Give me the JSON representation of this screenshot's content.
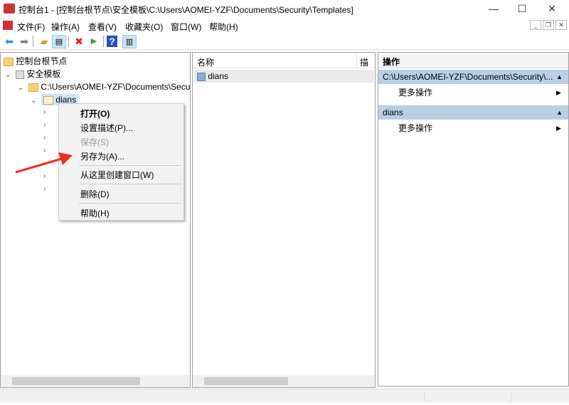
{
  "window": {
    "title": "控制台1 - [控制台根节点\\安全模板\\C:\\Users\\AOMEI-YZF\\Documents\\Security\\Templates]",
    "min": "—",
    "max": "☐",
    "close": "✕"
  },
  "menu": [
    "文件(F)",
    "操作(A)",
    "查看(V)",
    "收藏夹(O)",
    "窗口(W)",
    "帮助(H)"
  ],
  "mdi": {
    "min": "_",
    "restore": "❐",
    "close": "✕"
  },
  "tree": {
    "root": "控制台根节点",
    "templates": "安全模板",
    "path": "C:\\Users\\AOMEI-YZF\\Documents\\Secur",
    "dians": "dians"
  },
  "context_menu": {
    "open": "打开(O)",
    "set_desc": "设置描述(P)...",
    "save": "保存(S)",
    "save_as": "另存为(A)...",
    "new_window": "从这里创建窗口(W)",
    "delete": "删除(D)",
    "help": "帮助(H)"
  },
  "list": {
    "col_name": "名称",
    "col_desc": "描述",
    "items": [
      "dians"
    ]
  },
  "actions": {
    "header": "操作",
    "group1": "C:\\Users\\AOMEI-YZF\\Documents\\Security\\...",
    "group2": "dians",
    "more": "更多操作"
  },
  "colors": {
    "accent": "#b9cfe6",
    "arrow": "#e8302a"
  }
}
